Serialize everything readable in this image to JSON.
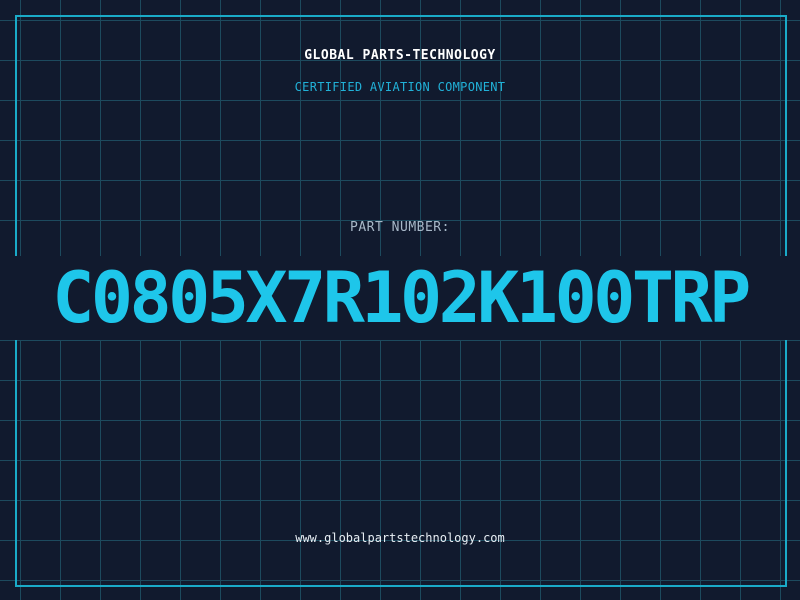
{
  "header": {
    "company": "GLOBAL PARTS-TECHNOLOGY",
    "tagline": "CERTIFIED AVIATION COMPONENT"
  },
  "part": {
    "label": "PART NUMBER:",
    "number": "C0805X7R102K100TRP"
  },
  "footer": {
    "website": "www.globalpartstechnology.com"
  },
  "colors": {
    "background": "#111a2e",
    "grid": "#1d4a5e",
    "frame": "#1aaac8",
    "accent": "#1ec6ea"
  }
}
